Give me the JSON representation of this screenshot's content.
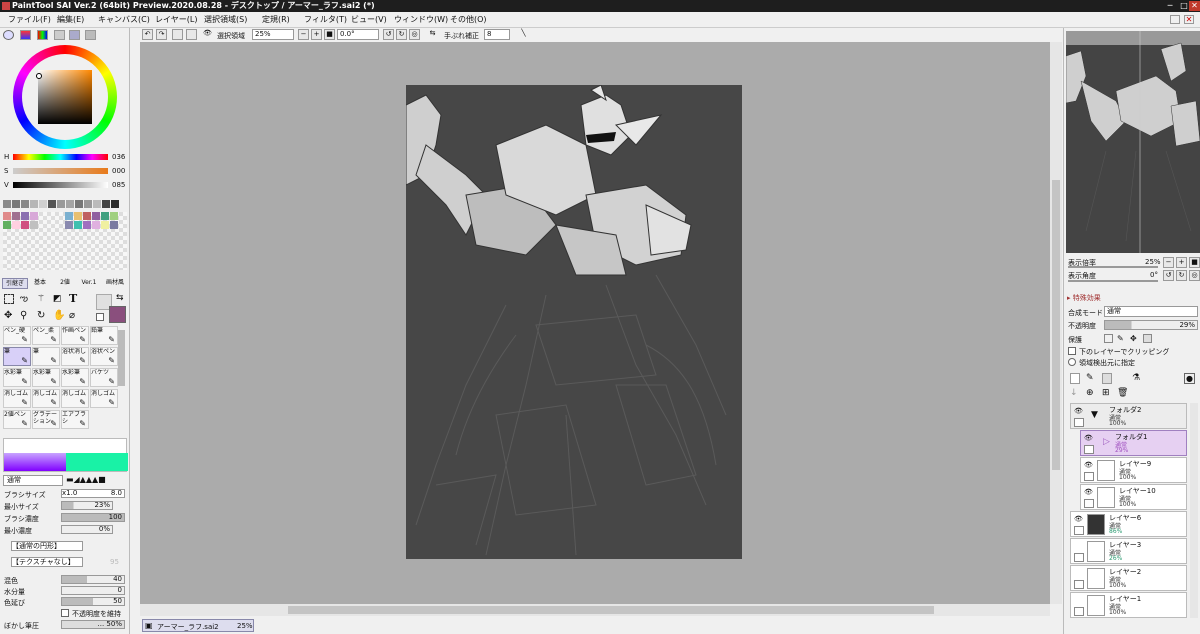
{
  "window": {
    "title": "PaintTool SAI Ver.2 (64bit) Preview.2020.08.28 - デスクトップ / アーマー_ラフ.sai2 (*)"
  },
  "menu": [
    "ファイル(F)",
    "編集(E)",
    "キャンバス(C)",
    "レイヤー(L)",
    "選択領域(S)",
    "定規(R)",
    "フィルタ(T)",
    "ビュー(V)",
    "ウィンドウ(W)",
    "その他(O)"
  ],
  "toolbar": {
    "selection_label": "選択領域",
    "zoom": "25%",
    "angle": "0.0°",
    "stabilizer_label": "手ぶれ補正",
    "stabilizer": "8"
  },
  "color": {
    "h_label": "H",
    "h": "036",
    "s_label": "S",
    "s": "000",
    "v_label": "V",
    "v": "085",
    "main": "#8a4f7d",
    "bg": "#e0e0e0"
  },
  "tool_tabs": [
    "引継ぎ",
    "基本",
    "2値",
    "Ver.1",
    "画材風"
  ],
  "brushes": [
    {
      "name": "ペン_硬"
    },
    {
      "name": "ペン_柔"
    },
    {
      "name": "作画ペン"
    },
    {
      "name": "鉛筆"
    },
    {
      "name": "筆"
    },
    {
      "name": "筆"
    },
    {
      "name": "浴状消し"
    },
    {
      "name": "浴状ペン"
    },
    {
      "name": "水彩筆"
    },
    {
      "name": "水彩筆"
    },
    {
      "name": "水彩筆"
    },
    {
      "name": "バケツ"
    },
    {
      "name": "消しゴム"
    },
    {
      "name": "消しゴム"
    },
    {
      "name": "消しゴム"
    },
    {
      "name": "消しゴム"
    },
    {
      "name": "2値ペン"
    },
    {
      "name": "グラデーション"
    },
    {
      "name": "エアブラシ"
    }
  ],
  "brush_settings": {
    "mode": "通常",
    "size_label": "ブラシサイズ",
    "size_mult": "x1.0",
    "size": "8.0",
    "min_size_label": "最小サイズ",
    "min_size": "23%",
    "density_label": "ブラシ濃度",
    "density": "100",
    "min_density_label": "最小濃度",
    "min_density": "0%",
    "shape": "【通常の円形】",
    "texture": "【テクスチャなし】",
    "texture_val": "95",
    "blend_label": "混色",
    "blend": "40",
    "water_label": "水分量",
    "water": "0",
    "stretch_label": "色延び",
    "stretch": "50",
    "keep_opacity_label": "不透明度を維持",
    "blur_label": "ぼかし筆圧",
    "blur": "... 50%"
  },
  "navigator": {
    "zoom_label": "表示倍率",
    "zoom": "25%",
    "angle_label": "表示角度",
    "angle": "0°"
  },
  "layer_props": {
    "effects_label": "特殊効果",
    "blend_label": "合成モード",
    "blend": "通常",
    "opacity_label": "不透明度",
    "opacity": "29%",
    "protect_label": "保護",
    "clip_label": "下のレイヤーでクリッピング",
    "select_src_label": "領域検出元に指定"
  },
  "layers": [
    {
      "name": "フォルダ2",
      "mode": "通常",
      "opacity": "100%"
    },
    {
      "name": "フォルダ1",
      "mode": "通常",
      "opacity": "29%"
    },
    {
      "name": "レイヤー9",
      "mode": "通常",
      "opacity": "100%"
    },
    {
      "name": "レイヤー10",
      "mode": "通常",
      "opacity": "100%"
    },
    {
      "name": "レイヤー6",
      "mode": "通常",
      "opacity": "86%"
    },
    {
      "name": "レイヤー3",
      "mode": "通常",
      "opacity": "26%"
    },
    {
      "name": "レイヤー2",
      "mode": "通常",
      "opacity": "100%"
    },
    {
      "name": "レイヤー1",
      "mode": "通常",
      "opacity": "100%"
    }
  ],
  "status": {
    "file": "アーマー_ラフ.sai2",
    "zoom": "25%"
  },
  "palette": [
    "#8a8a8a",
    "#7a7a7a",
    "#888",
    "#b6b6b6",
    "#cfcfcf",
    "#555",
    "#9a9a9a",
    "#a5a5a5",
    "#777",
    "#999",
    "#bbb",
    "#444",
    "#2b2b2b"
  ],
  "swatches": [
    "#e08a8a",
    "#a07090",
    "#8a6fb0",
    "#d8a8d8",
    "#7ab0d0",
    "#e8c070",
    "#c06060",
    "#9060a0",
    "#40a080",
    "#a0d080",
    "#60b060",
    "#ffd0e0",
    "#d05080",
    "#c0c0c0",
    "#8a8ab0",
    "#40c0b0",
    "#a070c0",
    "#e0b0e0",
    "#f0f0a0",
    "#7a7aa0"
  ]
}
